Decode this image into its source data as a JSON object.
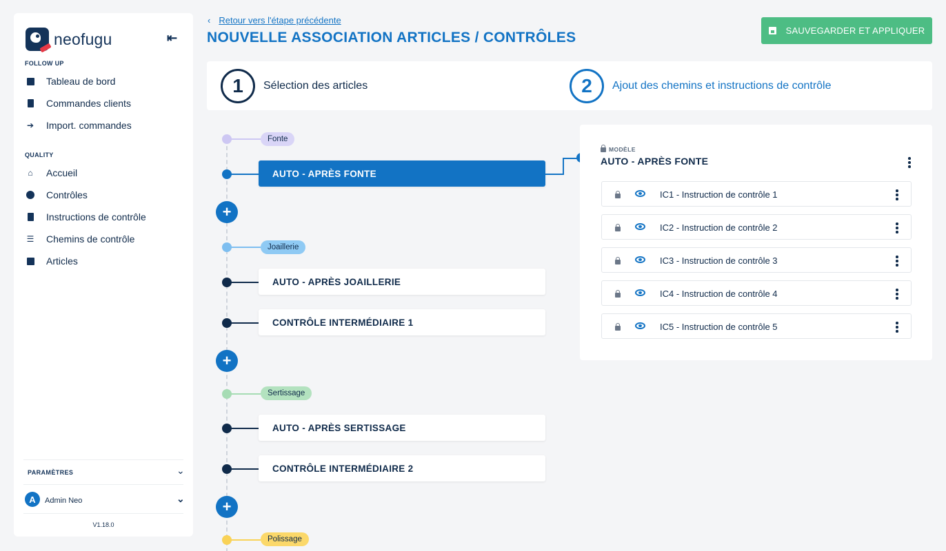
{
  "sidebar": {
    "brand": "neofugu",
    "sections": [
      {
        "title": "FOLLOW UP",
        "items": [
          {
            "label": "Tableau de bord",
            "icon": "dashboard-icon"
          },
          {
            "label": "Commandes clients",
            "icon": "clipboard-icon"
          },
          {
            "label": "Import. commandes",
            "icon": "import-icon"
          }
        ]
      },
      {
        "title": "QUALITY",
        "items": [
          {
            "label": "Accueil",
            "icon": "home-icon"
          },
          {
            "label": "Contrôles",
            "icon": "check-circle-icon"
          },
          {
            "label": "Instructions de contrôle",
            "icon": "clipboard-check-icon"
          },
          {
            "label": "Chemins de contrôle",
            "icon": "list-icon"
          },
          {
            "label": "Articles",
            "icon": "box-icon"
          }
        ]
      }
    ],
    "params_label": "PARAMÈTRES",
    "user": {
      "initial": "A",
      "name": "Admin Neo"
    },
    "version": "V1.18.0"
  },
  "header": {
    "back_label": "Retour vers l'étape précédente",
    "title": "NOUVELLE ASSOCIATION ARTICLES / CONTRÔLES",
    "save_label": "SAUVEGARDER ET APPLIQUER"
  },
  "stepper": {
    "steps": [
      {
        "number": "1",
        "label": "Sélection des articles"
      },
      {
        "number": "2",
        "label": "Ajout des chemins et instructions de contrôle"
      }
    ]
  },
  "timeline": {
    "groups": [
      {
        "tag": "Fonte",
        "tag_color": "#d9d5f7",
        "dot_color": "#cdc7f3",
        "cards": [
          "AUTO - APRÈS FONTE"
        ]
      },
      {
        "tag": "Joaillerie",
        "tag_color": "#8fcaf4",
        "dot_color": "#7dbef0",
        "cards": [
          "AUTO - APRÈS JOAILLERIE",
          "CONTRÔLE INTERMÉDIAIRE 1"
        ]
      },
      {
        "tag": "Sertissage",
        "tag_color": "#b3e2bf",
        "dot_color": "#a6dcb4",
        "cards": [
          "AUTO - APRÈS SERTISSAGE",
          "CONTRÔLE INTERMÉDIAIRE 2"
        ]
      },
      {
        "tag": "Polissage",
        "tag_color": "#fbd86a",
        "dot_color": "#f9d257",
        "cards": []
      }
    ],
    "plus_symbol": "+",
    "active_card": "AUTO - APRÈS FONTE"
  },
  "panel": {
    "model_label": "MODÈLE",
    "title": "AUTO - APRÈS FONTE",
    "instructions": [
      "IC1 - Instruction de contrôle 1",
      "IC2 - Instruction de contrôle 2",
      "IC3 - Instruction de contrôle 3",
      "IC4 - Instruction de contrôle 4",
      "IC5 - Instruction de contrôle 5"
    ]
  },
  "colors": {
    "primary": "#1273c4",
    "navy": "#143359",
    "save": "#4dbd84"
  }
}
